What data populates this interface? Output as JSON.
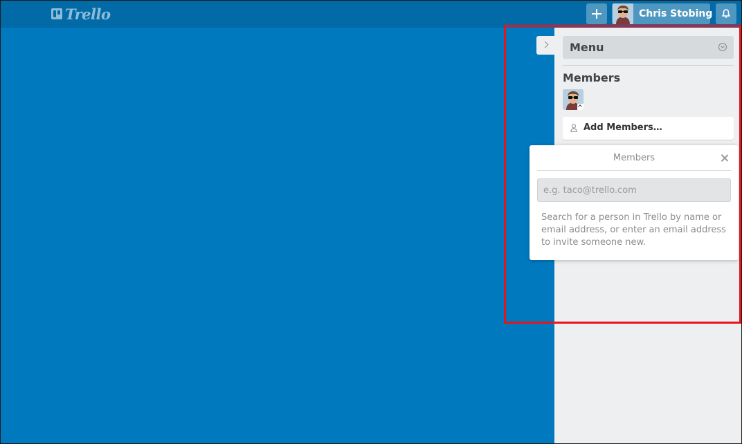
{
  "header": {
    "logo_text": "Trello",
    "add_label": "Create",
    "user_name": "Chris Stobing",
    "notifications_label": "Notifications"
  },
  "sidebar": {
    "menu_title": "Menu",
    "members_heading": "Members",
    "add_members_label": "Add Members…"
  },
  "popover": {
    "title": "Members",
    "input_placeholder": "e.g. taco@trello.com",
    "help_text": "Search for a person in Trello by name or email address, or enter an email address to invite someone new."
  },
  "colors": {
    "board_background": "#0079bf",
    "header_background": "#026aa7",
    "sidebar_background": "#edeff0",
    "highlight_border": "#e8131b"
  },
  "icons": [
    "trello-logo-icon",
    "plus-icon",
    "bell-icon",
    "chevron-right-icon",
    "chevron-down-circle-icon",
    "person-icon",
    "close-icon"
  ]
}
